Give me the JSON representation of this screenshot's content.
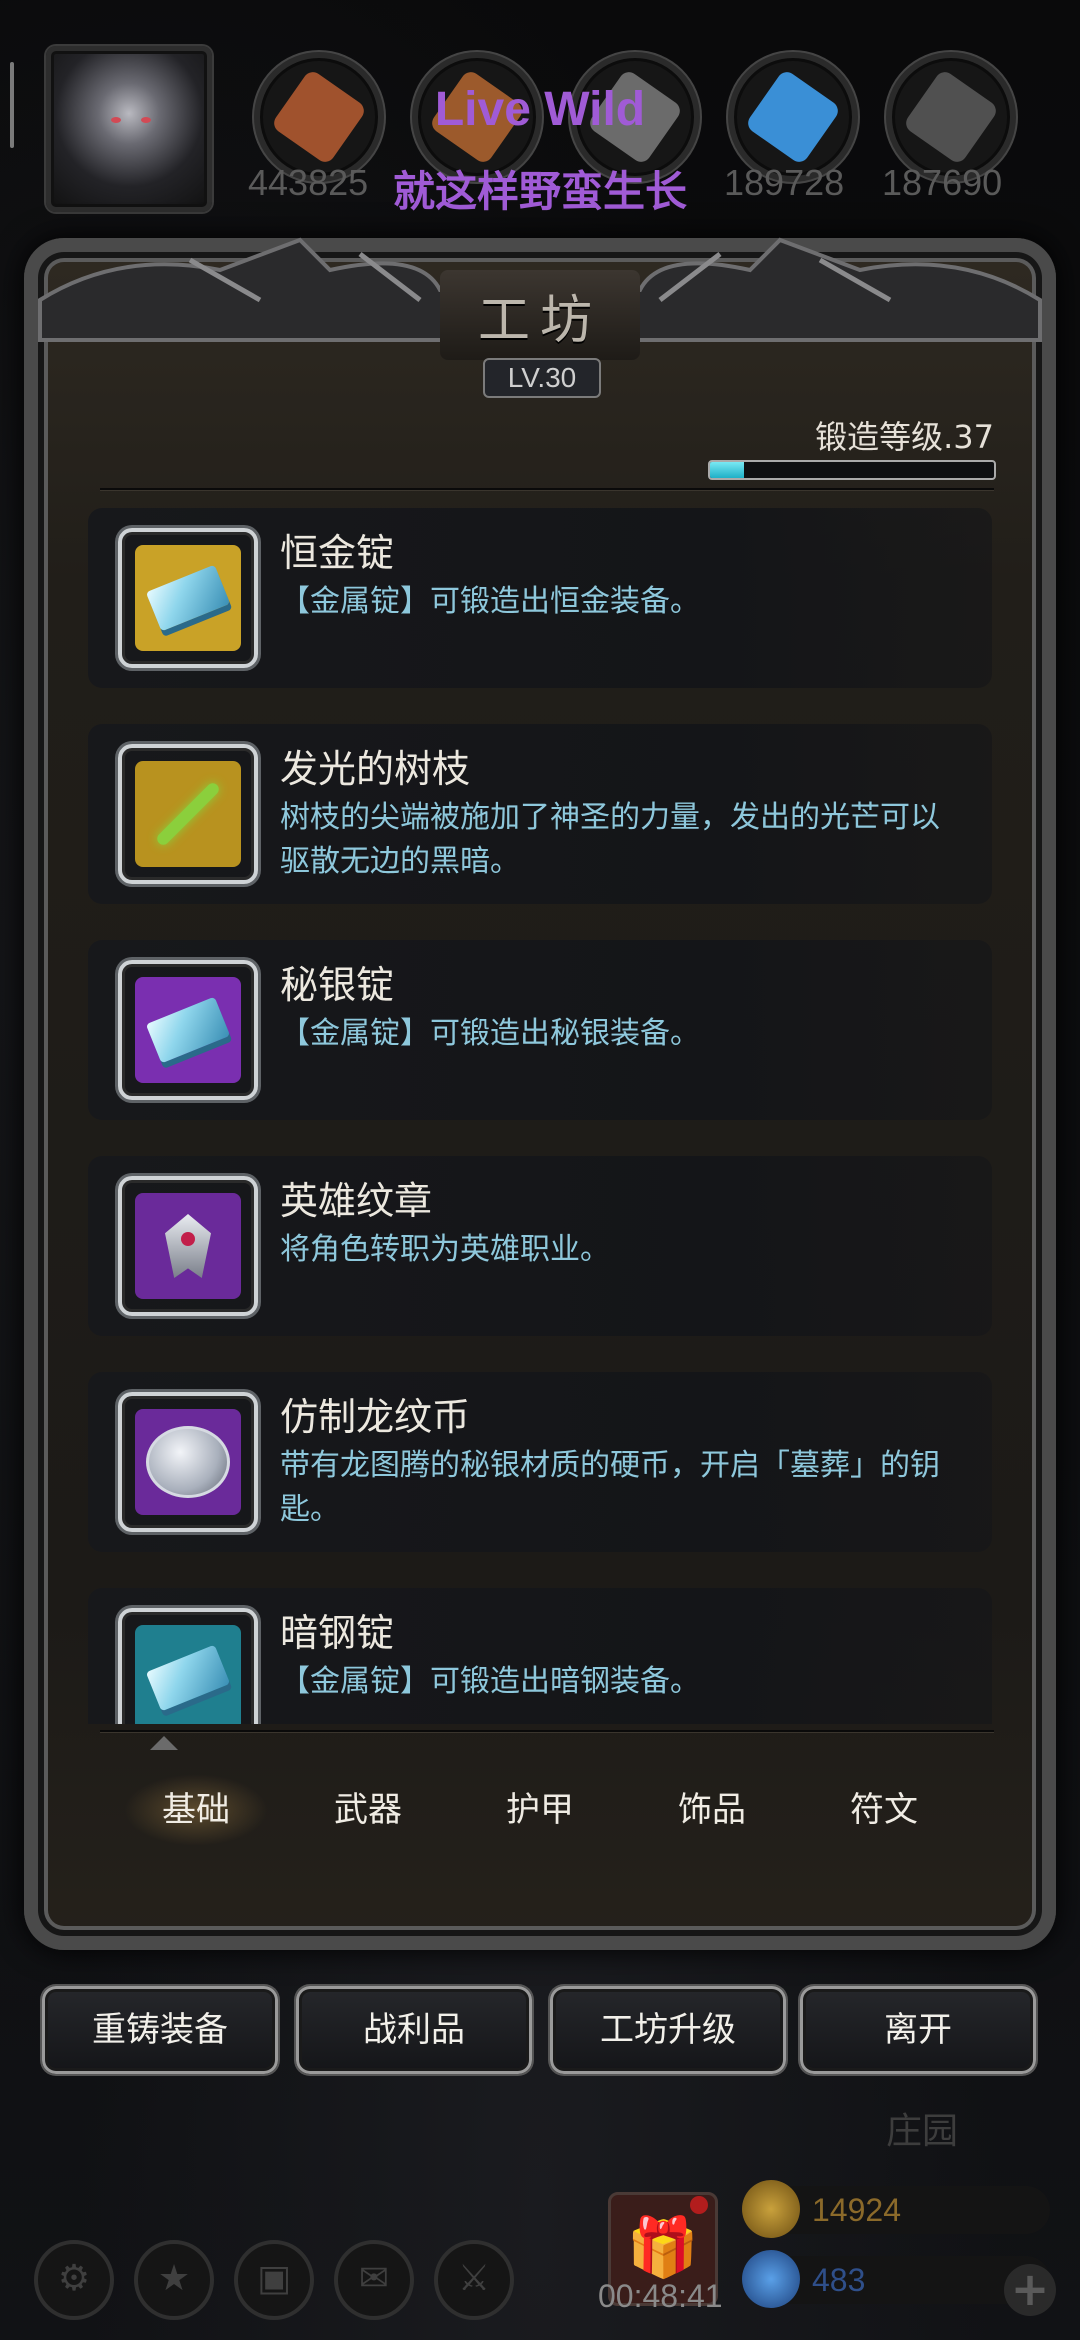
{
  "header": {
    "promo_en": "Live Wild",
    "promo_cn": "就这样野蛮生长",
    "resources": [
      {
        "icon": "meat-icon",
        "value": "443825",
        "color": "#a0522d"
      },
      {
        "icon": "wood-icon",
        "value": "",
        "color": "#9c5a2c"
      },
      {
        "icon": "stone-icon",
        "value": "",
        "color": "#6b6b6b"
      },
      {
        "icon": "crystal-icon",
        "value": "189728",
        "color": "#3a8fd6"
      },
      {
        "icon": "iron-icon",
        "value": "187690",
        "color": "#505050"
      }
    ]
  },
  "panel": {
    "title": "工坊",
    "level": "LV.30",
    "forge_label": "锻造等级.37",
    "forge_progress": 0.12
  },
  "items": [
    {
      "name": "恒金锭",
      "desc": "【金属锭】可锻造出恒金装备。",
      "frame_color": "#c9a227",
      "icon": "ingot-icon"
    },
    {
      "name": "发光的树枝",
      "desc": "树枝的尖端被施加了神圣的力量，发出的光芒可以驱散无边的黑暗。",
      "frame_color": "#b8921f",
      "icon": "glowing-branch-icon"
    },
    {
      "name": "秘银锭",
      "desc": "【金属锭】可锻造出秘银装备。",
      "frame_color": "#7a2fb0",
      "icon": "ingot-icon"
    },
    {
      "name": "英雄纹章",
      "desc": "将角色转职为英雄职业。",
      "frame_color": "#6a2a9a",
      "icon": "hero-emblem-icon"
    },
    {
      "name": "仿制龙纹币",
      "desc": "带有龙图腾的秘银材质的硬币，开启「墓葬」的钥匙。",
      "frame_color": "#6a2a9a",
      "icon": "dragon-coin-icon"
    },
    {
      "name": "暗钢锭",
      "desc": "【金属锭】可锻造出暗钢装备。",
      "frame_color": "#1f7f8f",
      "icon": "ingot-icon"
    }
  ],
  "tabs": [
    "基础",
    "武器",
    "护甲",
    "饰品",
    "符文"
  ],
  "buttons": {
    "recast": "重铸装备",
    "loot": "战利品",
    "upgrade": "工坊升级",
    "leave": "离开"
  },
  "bottom": {
    "estate": "庄园",
    "timer": "00:48:41",
    "gold": "14924",
    "gems": "483",
    "gold_color": "#8b6a2a",
    "gem_color": "#2f4f8a"
  }
}
